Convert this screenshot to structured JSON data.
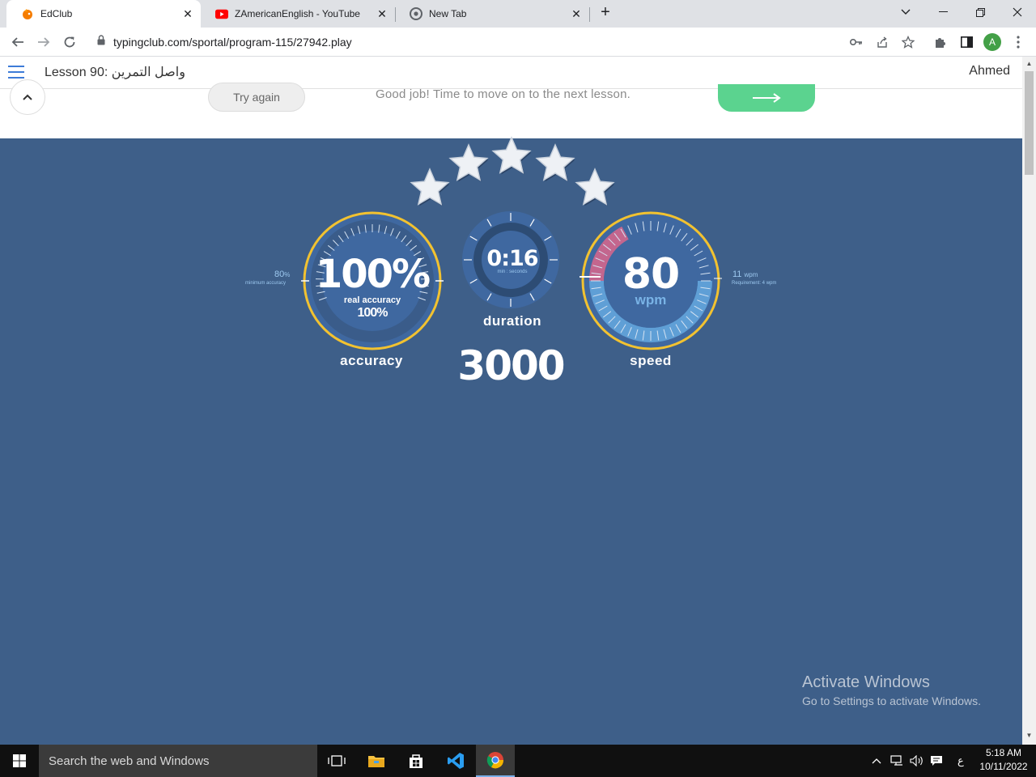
{
  "browser": {
    "tabs": [
      {
        "title": "EdClub",
        "active": true,
        "icon": "edclub-favicon"
      },
      {
        "title": "ZAmericanEnglish - YouTube",
        "active": false,
        "icon": "youtube-favicon"
      },
      {
        "title": "New Tab",
        "active": false,
        "icon": "chrome-favicon"
      }
    ],
    "url": "typingclub.com/sportal/program-115/27942.play",
    "profile_initial": "A"
  },
  "header": {
    "lesson_title": "Lesson 90: واصل التمرين",
    "user_name": "Ahmed"
  },
  "result_bar": {
    "try_again_label": "Try again",
    "message": "Good job! Time to move on to the next lesson."
  },
  "stats": {
    "stars_earned": 5,
    "stars_total": 5,
    "accuracy": {
      "value": "100%",
      "real_label": "real accuracy",
      "real_value": "100%",
      "label": "accuracy",
      "min_value": "80",
      "min_unit": "%",
      "min_label": "minimum accuracy"
    },
    "duration": {
      "value": "0:16",
      "sub": "min : seconds",
      "label": "duration"
    },
    "speed": {
      "value": "80",
      "unit": "wpm",
      "label": "speed",
      "side_value": "11",
      "side_unit": "wpm",
      "side_label": "Requirement: 4 wpm"
    },
    "score": "3000"
  },
  "watermark": {
    "title": "Activate Windows",
    "subtitle": "Go to Settings to activate Windows."
  },
  "taskbar": {
    "search_placeholder": "Search the web and Windows",
    "input_indicator": "ع",
    "time": "5:18 AM",
    "date": "10/11/2022"
  }
}
